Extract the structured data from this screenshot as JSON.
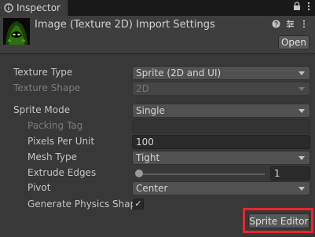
{
  "tab": {
    "icon": "info-icon",
    "label": "Inspector"
  },
  "window_icons": [
    "lock-icon",
    "menu-kebab-icon"
  ],
  "header": {
    "title": "Image (Texture 2D) Import Settings",
    "icons": [
      "help-icon",
      "preset-icon",
      "context-menu-icon"
    ],
    "open_label": "Open"
  },
  "fields": {
    "texture_type": {
      "label": "Texture Type",
      "value": "Sprite (2D and UI)"
    },
    "texture_shape": {
      "label": "Texture Shape",
      "value": "2D"
    },
    "sprite_mode": {
      "label": "Sprite Mode",
      "value": "Single"
    },
    "packing_tag": {
      "label": "Packing Tag",
      "value": ""
    },
    "pixels_per_unit": {
      "label": "Pixels Per Unit",
      "value": "100"
    },
    "mesh_type": {
      "label": "Mesh Type",
      "value": "Tight"
    },
    "extrude_edges": {
      "label": "Extrude Edges",
      "value": "1",
      "slider_fraction": 0.03
    },
    "pivot": {
      "label": "Pivot",
      "value": "Center"
    },
    "generate_physics_shape": {
      "label": "Generate Physics Shap",
      "checked": true,
      "check_glyph": "✓"
    }
  },
  "sprite_editor_label": "Sprite Editor",
  "colors": {
    "highlight": "#e8262f",
    "background": "#383838"
  }
}
